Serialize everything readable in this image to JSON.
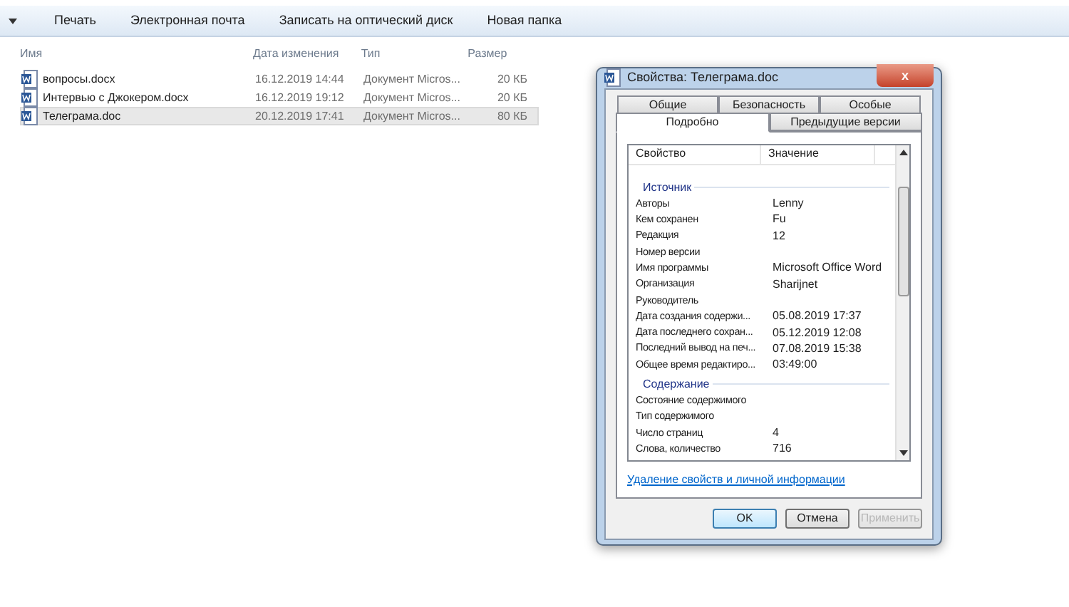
{
  "toolbar": {
    "items": [
      "Печать",
      "Электронная почта",
      "Записать на оптический диск",
      "Новая папка"
    ]
  },
  "file_list": {
    "columns": [
      "Имя",
      "Дата изменения",
      "Тип",
      "Размер"
    ],
    "rows": [
      {
        "name": "вопросы.docx",
        "date": "16.12.2019 14:44",
        "type": "Документ Micros...",
        "size": "20 КБ",
        "selected": false
      },
      {
        "name": "Интервью с Джокером.docx",
        "date": "16.12.2019 19:12",
        "type": "Документ Micros...",
        "size": "20 КБ",
        "selected": false
      },
      {
        "name": "Телеграма.doc",
        "date": "20.12.2019 17:41",
        "type": "Документ Micros...",
        "size": "80 КБ",
        "selected": true
      }
    ]
  },
  "dialog": {
    "title": "Свойства: Телеграма.doc",
    "close": "x",
    "tab_rows": [
      [
        {
          "label": "Общие",
          "selected": false
        },
        {
          "label": "Безопасность",
          "selected": false
        },
        {
          "label": "Особые",
          "selected": false
        }
      ],
      [
        {
          "label": "Подробно",
          "selected": true
        },
        {
          "label": "Предыдущие версии",
          "selected": false
        }
      ]
    ],
    "columns": [
      "Свойство",
      "Значение"
    ],
    "properties": [
      {
        "kind": "group",
        "name": "Источник"
      },
      {
        "kind": "property",
        "name": "Авторы",
        "value": "Lenny"
      },
      {
        "kind": "property",
        "name": "Кем сохранен",
        "value": "Fu"
      },
      {
        "kind": "property",
        "name": "Редакция",
        "value": "12"
      },
      {
        "kind": "property",
        "name": "Номер версии"
      },
      {
        "kind": "property",
        "name": "Имя программы",
        "value": "Microsoft Office Word"
      },
      {
        "kind": "property",
        "name": "Организация",
        "value": "Sharijnet"
      },
      {
        "kind": "property",
        "name": "Руководитель"
      },
      {
        "kind": "property",
        "name": "Дата создания содержи...",
        "value": "05.08.2019 17:37"
      },
      {
        "kind": "property",
        "name": "Дата последнего сохран...",
        "value": "05.12.2019 12:08"
      },
      {
        "kind": "property",
        "name": "Последний вывод на печ...",
        "value": "07.08.2019 15:38"
      },
      {
        "kind": "property",
        "name": "Общее время редактиро...",
        "value": "03:49:00"
      },
      {
        "kind": "group",
        "name": "Содержание"
      },
      {
        "kind": "property",
        "name": "Состояние содержимого"
      },
      {
        "kind": "property",
        "name": "Тип содержимого"
      },
      {
        "kind": "property",
        "name": "Число страниц",
        "value": "4"
      },
      {
        "kind": "property",
        "name": "Слова, количество",
        "value": "716"
      }
    ],
    "link": "Удаление свойств и личной информации",
    "buttons": [
      {
        "label": "OK",
        "disabled": false,
        "default": true
      },
      {
        "label": "Отмена",
        "disabled": false,
        "default": false
      },
      {
        "label": "Применить",
        "disabled": true,
        "default": false
      }
    ]
  }
}
